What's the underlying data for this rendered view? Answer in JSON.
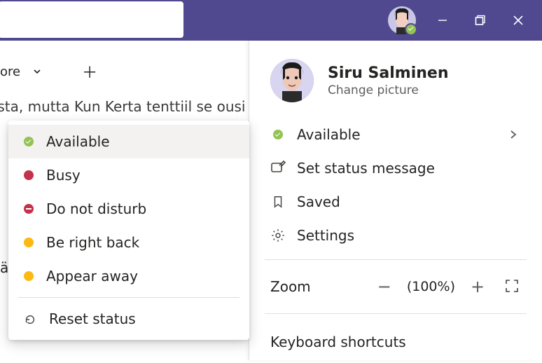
{
  "titlebar": {
    "presence": "available"
  },
  "bg": {
    "more_label": "ore",
    "clipped_line": ".sta, mutta Kun Kerta tenttiil se ousi k",
    "partial_char": "ä"
  },
  "profile": {
    "name": "Siru Salminen",
    "change_picture": "Change picture"
  },
  "panel": {
    "available": "Available",
    "set_status": "Set status message",
    "saved": "Saved",
    "settings": "Settings",
    "zoom_label": "Zoom",
    "zoom_value": "(100%)",
    "keyboard_shortcuts": "Keyboard shortcuts"
  },
  "status_menu": {
    "available": "Available",
    "busy": "Busy",
    "dnd": "Do not disturb",
    "brb": "Be right back",
    "away": "Appear away",
    "reset": "Reset status"
  }
}
